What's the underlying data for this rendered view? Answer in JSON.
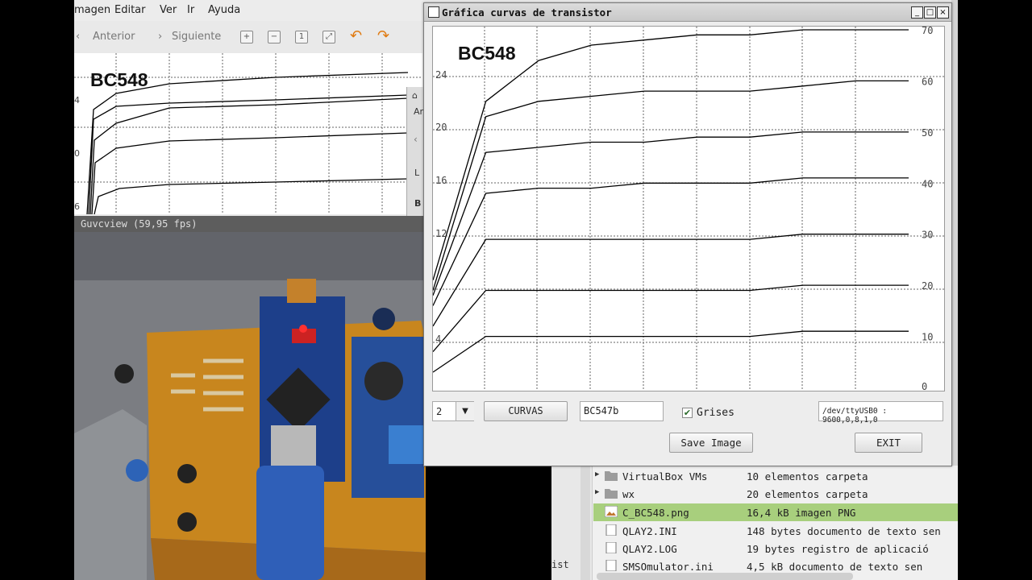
{
  "viewer": {
    "menu": [
      "magen",
      "Editar",
      "Ver",
      "Ir",
      "Ayuda"
    ],
    "toolbar": {
      "prev_label": "Anterior",
      "next_label": "Siguiente"
    },
    "graph_title": "BC548",
    "y_ticks": [
      "4",
      "0",
      "6"
    ],
    "side_letters": [
      "Ar",
      "L",
      "B"
    ]
  },
  "webcam": {
    "title": "Guvcview  (59,95 fps)"
  },
  "dialog": {
    "title": "Gráfica curvas  de transistor",
    "plot": {
      "title": "BC548",
      "left_ticks": [
        "24",
        "20",
        "16",
        "12",
        "4"
      ],
      "right_ticks": [
        "70",
        "60",
        "50",
        "40",
        "30",
        "20",
        "10",
        "0"
      ]
    },
    "controls": {
      "combo_value": "2",
      "curvas_label": "CURVAS",
      "name_value": "BC547b",
      "grises_label": "Grises",
      "grises_checked": true,
      "port_value": "/dev/ttyUSB0 : 9600,0,8,1,0",
      "save_label": "Save Image",
      "exit_label": "EXIT"
    }
  },
  "files": {
    "rows": [
      {
        "name": "VirtualBox VMs",
        "desc": "10 elementos carpeta",
        "type": "folder"
      },
      {
        "name": "wx",
        "desc": "20 elementos carpeta",
        "type": "folder"
      },
      {
        "name": "C_BC548.png",
        "desc": "16,4 kB imagen PNG",
        "type": "image",
        "selected": true
      },
      {
        "name": "QLAY2.INI",
        "desc": "148 bytes documento de texto sen",
        "type": "doc"
      },
      {
        "name": "QLAY2.LOG",
        "desc": "19 bytes registro de aplicació",
        "type": "doc"
      },
      {
        "name": "SMSOmulator.ini",
        "desc": "4,5 kB documento de texto sen",
        "type": "doc"
      }
    ],
    "side_label": "ist"
  },
  "chart_data": {
    "type": "line",
    "title": "BC548",
    "grid": true,
    "series": [
      {
        "x": [
          0,
          1,
          2,
          3,
          4,
          5,
          6,
          7,
          8,
          9
        ],
        "values": [
          3,
          10,
          10,
          10,
          10,
          10,
          10,
          11,
          11,
          11
        ]
      },
      {
        "x": [
          0,
          1,
          2,
          3,
          4,
          5,
          6,
          7,
          8,
          9
        ],
        "values": [
          7,
          19,
          19,
          19,
          19,
          19,
          19,
          20,
          20,
          20
        ]
      },
      {
        "x": [
          0,
          1,
          2,
          3,
          4,
          5,
          6,
          7,
          8,
          9
        ],
        "values": [
          12,
          29,
          29,
          29,
          29,
          29,
          29,
          30,
          30,
          30
        ]
      },
      {
        "x": [
          0,
          1,
          2,
          3,
          4,
          5,
          6,
          7,
          8,
          9
        ],
        "values": [
          16,
          38,
          39,
          39,
          40,
          40,
          40,
          41,
          41,
          41
        ]
      },
      {
        "x": [
          0,
          1,
          2,
          3,
          4,
          5,
          6,
          7,
          8,
          9
        ],
        "values": [
          18,
          46,
          47,
          48,
          48,
          49,
          49,
          50,
          50,
          50
        ]
      },
      {
        "x": [
          0,
          1,
          2,
          3,
          4,
          5,
          6,
          7,
          8,
          9
        ],
        "values": [
          19,
          53,
          56,
          57,
          58,
          58,
          58,
          59,
          60,
          60
        ]
      },
      {
        "x": [
          0,
          1,
          2,
          3,
          4,
          5,
          6,
          7,
          8,
          9
        ],
        "values": [
          21,
          56,
          64,
          67,
          68,
          69,
          69,
          70,
          70,
          70
        ]
      }
    ],
    "ylim": [
      0,
      70
    ],
    "xlim": [
      0,
      9
    ]
  }
}
